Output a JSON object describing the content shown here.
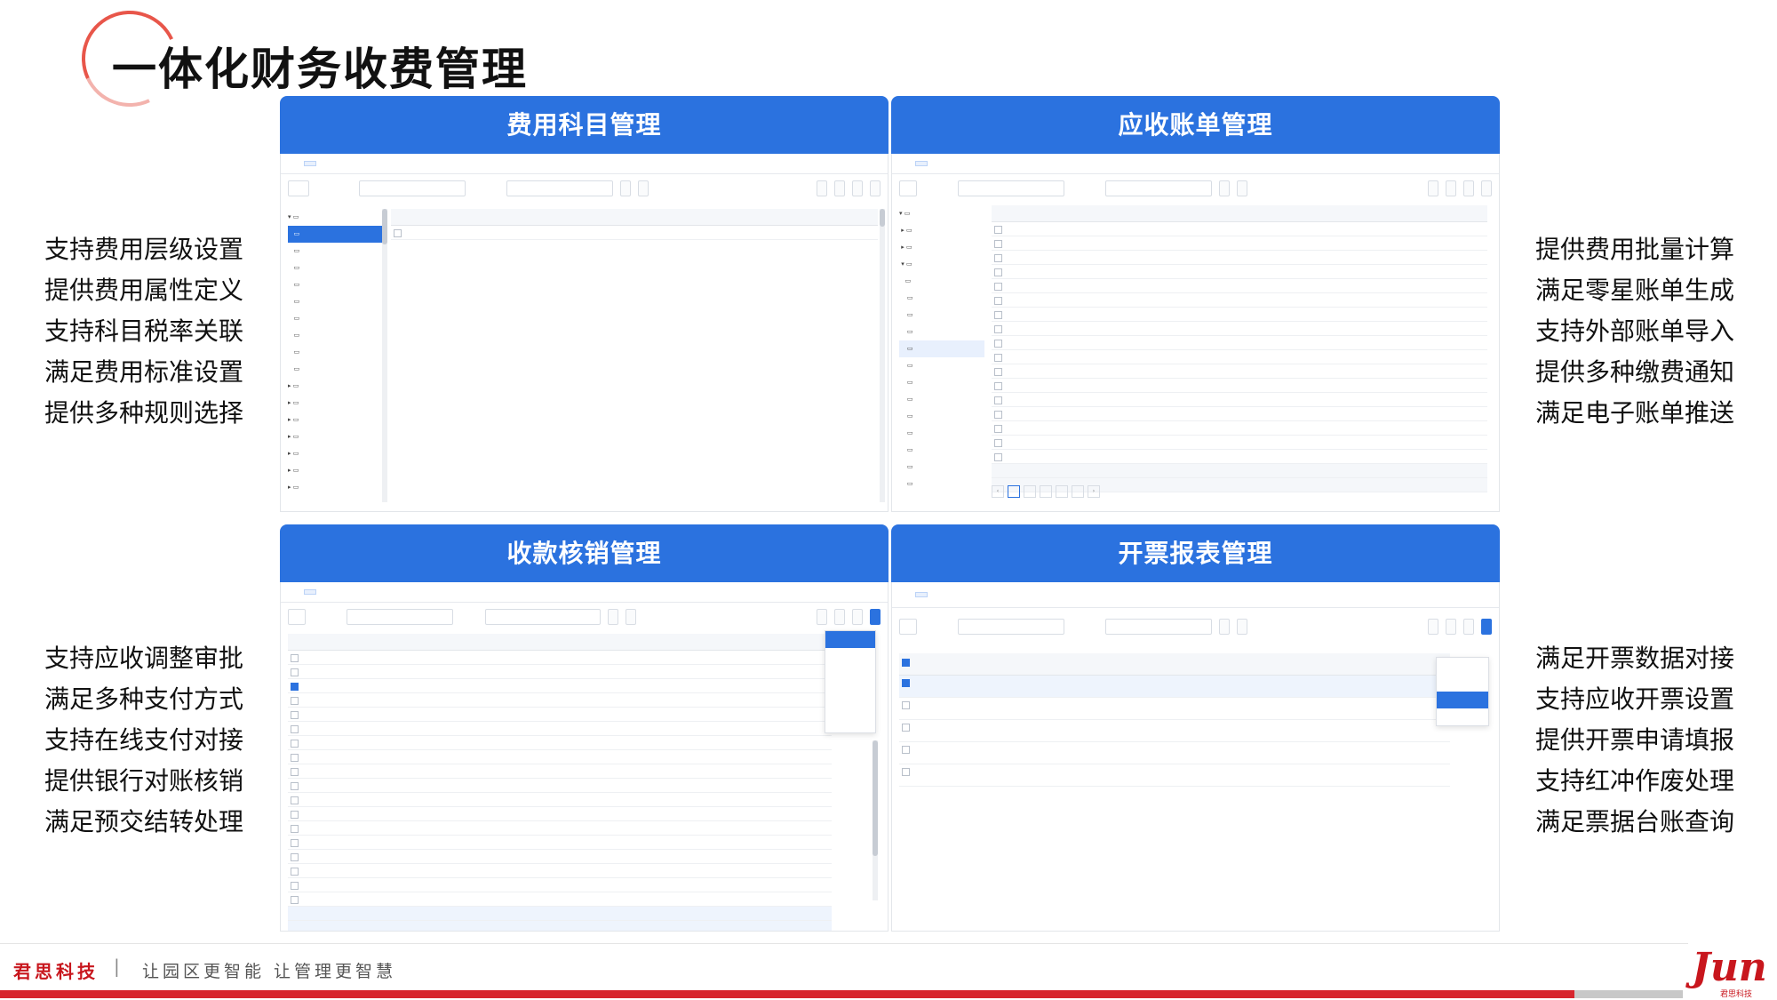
{
  "page": {
    "title": "一体化财务收费管理"
  },
  "panels": {
    "p1": {
      "title": "费用科目管理"
    },
    "p2": {
      "title": "应收账单管理"
    },
    "p3": {
      "title": "收款核销管理"
    },
    "p4": {
      "title": "开票报表管理"
    }
  },
  "features": {
    "left_top": [
      "支持费用层级设置",
      "提供费用属性定义",
      "支持科目税率关联",
      "满足费用标准设置",
      "提供多种规则选择"
    ],
    "left_bottom": [
      "支持应收调整审批",
      "满足多种支付方式",
      "支持在线支付对接",
      "提供银行对账核销",
      "满足预交结转处理"
    ],
    "right_top": [
      "提供费用批量计算",
      "满足零星账单生成",
      "支持外部账单导入",
      "提供多种缴费通知",
      "满足电子账单推送"
    ],
    "right_bottom": [
      "满足开票数据对接",
      "支持应收开票设置",
      "提供开票申请填报",
      "支持红冲作废处理",
      "满足票据台账查询"
    ]
  },
  "footer": {
    "brand": "君思科技",
    "separator": "|",
    "slogan": "让园区更智能  让管理更智慧",
    "logo_mark": "Jun",
    "logo_sub": "君思科技"
  },
  "colors": {
    "accent": "#2b72df",
    "brand_red": "#d7262e",
    "title_arc": "#e8564a"
  }
}
